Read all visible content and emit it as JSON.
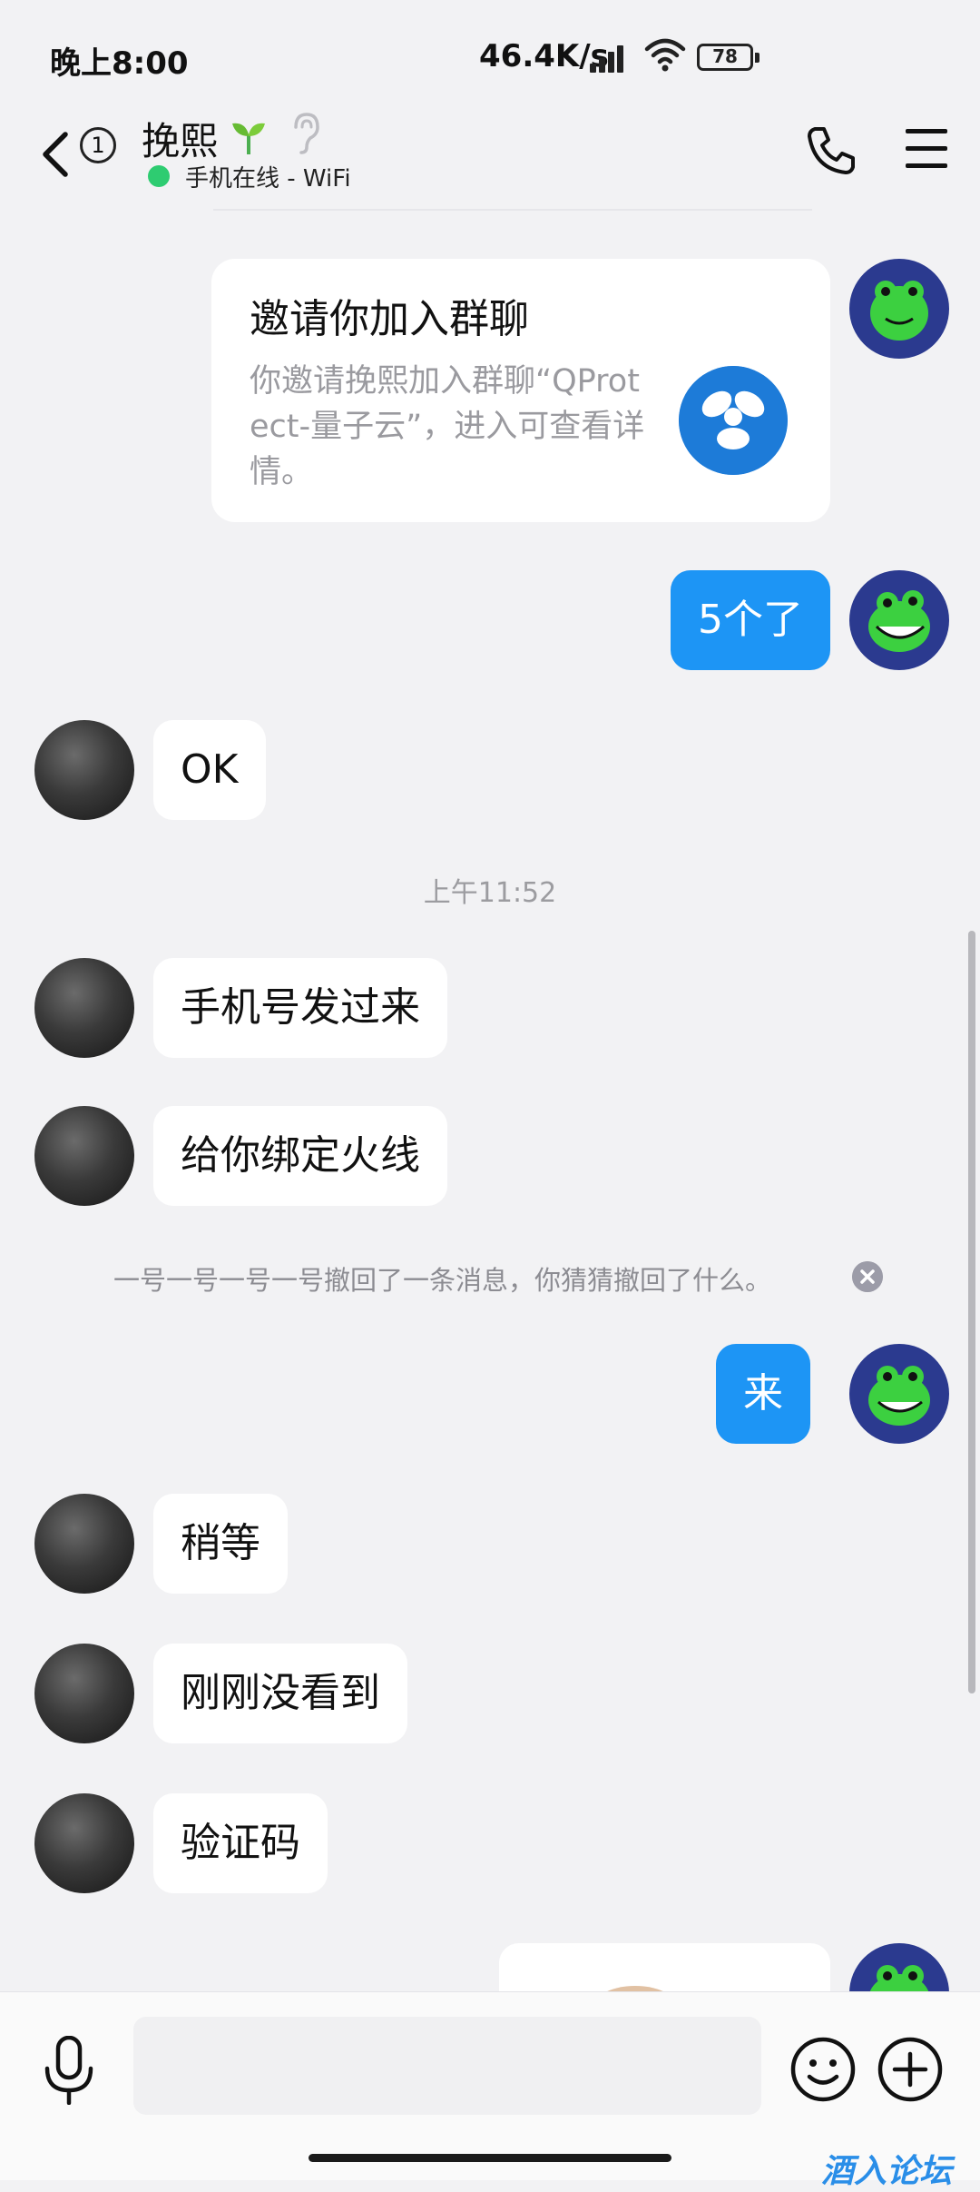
{
  "status_bar": {
    "time": "晚上8:00",
    "net_speed": "46.4K/s",
    "battery": "78"
  },
  "header": {
    "unread_count": "1",
    "contact_name": "挽熙",
    "online_status": "手机在线 - WiFi"
  },
  "messages": {
    "invite_card": {
      "title": "邀请你加入群聊",
      "desc": "你邀请挽熙加入群聊“QProtect-量子云”，进入可查看详情。"
    },
    "m1": "5个了",
    "m2": "OK",
    "time_label": "上午11:52",
    "m3": "手机号发过来",
    "m4": "给你绑定火线",
    "recall_notice": "一号一号一号一号撤回了一条消息，你猜猜撤回了什么。",
    "m5": "来",
    "m6": "稍等",
    "m7": "刚刚没看到",
    "m8": "验证码"
  },
  "input": {
    "placeholder": ""
  },
  "watermark": "酒入论坛",
  "colors": {
    "accent_blue": "#1d95f5",
    "online_green": "#2ecc71",
    "background": "#f2f2f4"
  },
  "icons": [
    "back-icon",
    "phone-icon",
    "menu-icon",
    "sprout-icon",
    "ear-icon",
    "mic-icon",
    "emoji-icon",
    "plus-icon",
    "dismiss-icon"
  ]
}
